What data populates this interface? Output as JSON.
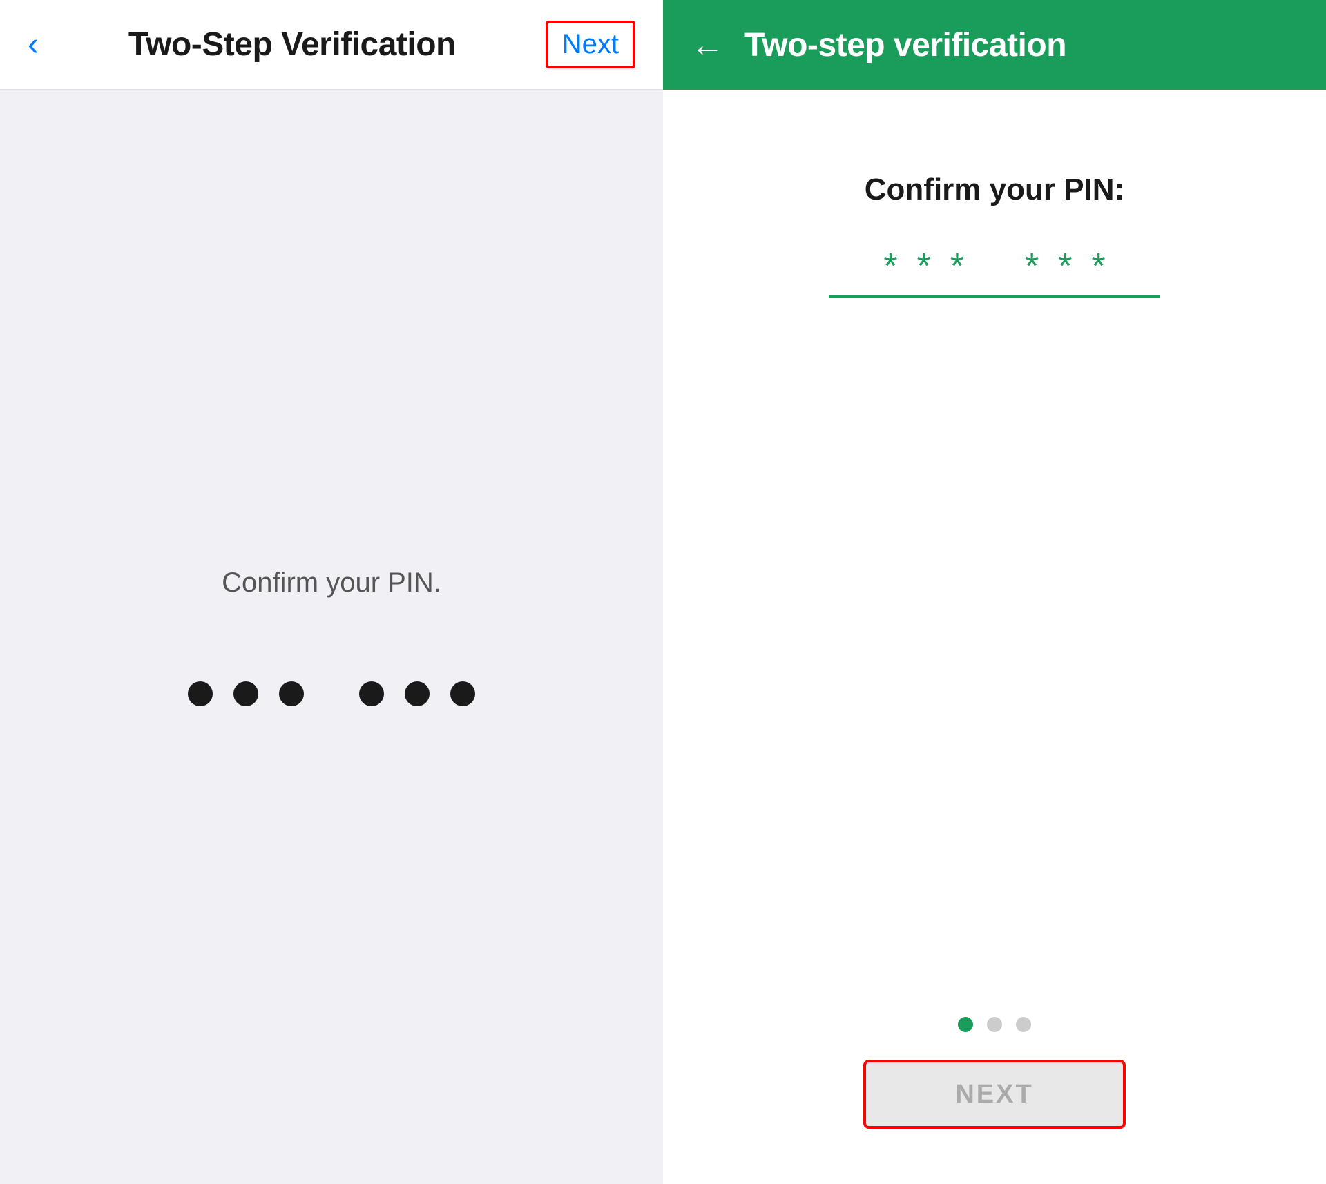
{
  "left": {
    "back_label": "‹",
    "title": "Two-Step Verification",
    "next_label": "Next",
    "confirm_text": "Confirm your PIN.",
    "dots_count": 6
  },
  "right": {
    "back_label": "←",
    "title": "Two-step verification",
    "confirm_text": "Confirm your PIN:",
    "pin_stars": "* * *   * * *",
    "next_label": "NEXT",
    "pagination": {
      "dots": [
        "active",
        "inactive",
        "inactive"
      ]
    }
  },
  "colors": {
    "green": "#1a9c5b",
    "blue": "#007aff",
    "highlight_border": "red"
  }
}
